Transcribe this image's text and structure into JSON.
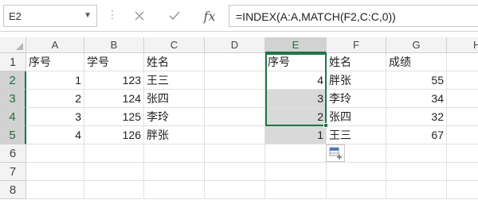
{
  "name_box": {
    "value": "E2"
  },
  "formula_bar": {
    "fx_label": "fx",
    "formula": "=INDEX(A:A,MATCH(F2,C:C,0))"
  },
  "columns": [
    "A",
    "B",
    "C",
    "D",
    "E",
    "F",
    "G",
    "H"
  ],
  "rows": [
    "1",
    "2",
    "3",
    "4",
    "5",
    "6",
    "7",
    "8"
  ],
  "cells": {
    "A1": "序号",
    "B1": "学号",
    "C1": "姓名",
    "E1": "序号",
    "F1": "姓名",
    "G1": "成绩",
    "A2": "1",
    "B2": "123",
    "C2": "王三",
    "E2": "4",
    "F2": "胖张",
    "G2": "55",
    "A3": "2",
    "B3": "124",
    "C3": "张四",
    "E3": "3",
    "F3": "李玲",
    "G3": "34",
    "A4": "3",
    "B4": "125",
    "C4": "李玲",
    "E4": "2",
    "F4": "张四",
    "G4": "32",
    "A5": "4",
    "B5": "126",
    "C5": "胖张",
    "E5": "1",
    "F5": "王三",
    "G5": "67"
  },
  "selection": {
    "range": "E2:E5",
    "active_cell": "E2"
  },
  "icons": {
    "name_box_dropdown": "chevron-down-icon",
    "cancel": "close-icon",
    "enter": "check-icon",
    "function": "fx-icon",
    "quick_analysis": "quick-analysis-icon"
  }
}
